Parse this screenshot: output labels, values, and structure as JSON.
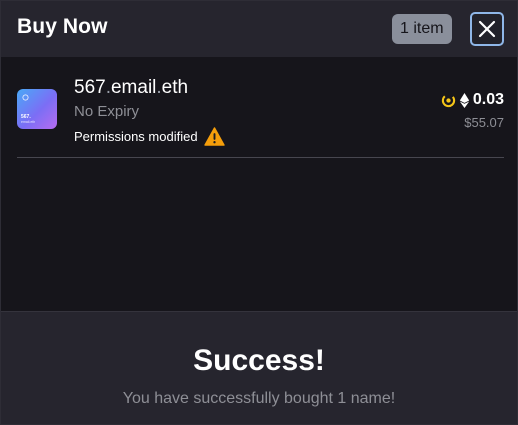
{
  "header": {
    "title": "Buy Now",
    "count_badge": "1 item",
    "close_icon": "close-icon"
  },
  "item": {
    "name_label": "567",
    "name_domain": "email",
    "name_tld": "eth",
    "expiry": "No Expiry",
    "permissions": "Permissions modified",
    "warning_icon": "warning-icon",
    "marketplace_icon": "marketplace-icon",
    "currency_icon": "eth-icon",
    "price_eth": "0.03",
    "price_usd": "$55.07",
    "thumb_name": "567.",
    "thumb_sub": "email.eth"
  },
  "footer": {
    "title": "Success!",
    "message": "You have successfully bought 1 name!"
  },
  "colors": {
    "background": "#16151b",
    "header_background": "#26252e",
    "accent_close_border": "#8fb7e8",
    "warning": "#f59e0b",
    "marketplace_yellow": "#f5c518"
  }
}
